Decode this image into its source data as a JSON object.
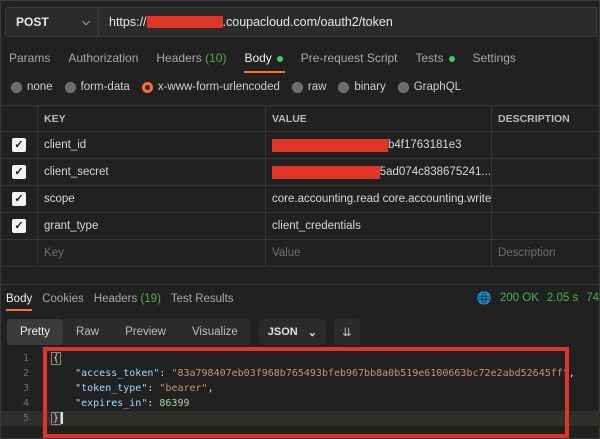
{
  "request": {
    "method": "POST",
    "url_prefix": "https://",
    "url_suffix": ".coupacloud.com/oauth2/token"
  },
  "request_tabs": [
    {
      "label": "Params"
    },
    {
      "label": "Authorization"
    },
    {
      "label": "Headers",
      "count": "(10)"
    },
    {
      "label": "Body"
    },
    {
      "label": "Pre-request Script"
    },
    {
      "label": "Tests"
    },
    {
      "label": "Settings"
    }
  ],
  "body_types": [
    "none",
    "form-data",
    "x-www-form-urlencoded",
    "raw",
    "binary",
    "GraphQL"
  ],
  "table": {
    "headers": {
      "key": "KEY",
      "value": "VALUE",
      "description": "DESCRIPTION"
    },
    "rows": [
      {
        "key": "client_id",
        "value_tail": "b4f1763181e3"
      },
      {
        "key": "client_secret",
        "value_tail": "5ad074c838675241..."
      },
      {
        "key": "scope",
        "value": "core.accounting.read core.accounting.write c..."
      },
      {
        "key": "grant_type",
        "value": "client_credentials"
      }
    ],
    "placeholders": {
      "key": "Key",
      "value": "Value",
      "description": "Description"
    }
  },
  "response_tabs": [
    {
      "label": "Body"
    },
    {
      "label": "Cookies"
    },
    {
      "label": "Headers",
      "count": "(19)"
    },
    {
      "label": "Test Results"
    }
  ],
  "status": {
    "code": "200 OK",
    "time": "2.05 s",
    "size": "74"
  },
  "view_modes": [
    "Pretty",
    "Raw",
    "Preview",
    "Visualize"
  ],
  "format": "JSON",
  "code": {
    "line_numbers": [
      "1",
      "2",
      "3",
      "4",
      "5"
    ],
    "open_brace": "{",
    "close_brace": "}",
    "access_token_key": "\"access_token\"",
    "access_token_value": "\"83a798407eb03f968b765493bfeb967bb8a0b519e6100663bc72e2abd52645ff\"",
    "token_type_key": "\"token_type\"",
    "token_type_value": "\"bearer\"",
    "expires_in_key": "\"expires_in\"",
    "expires_in_value": "86399"
  },
  "colors": {
    "accent": "#ff6c37",
    "annotation": "#e03526",
    "success": "#4caf50"
  }
}
